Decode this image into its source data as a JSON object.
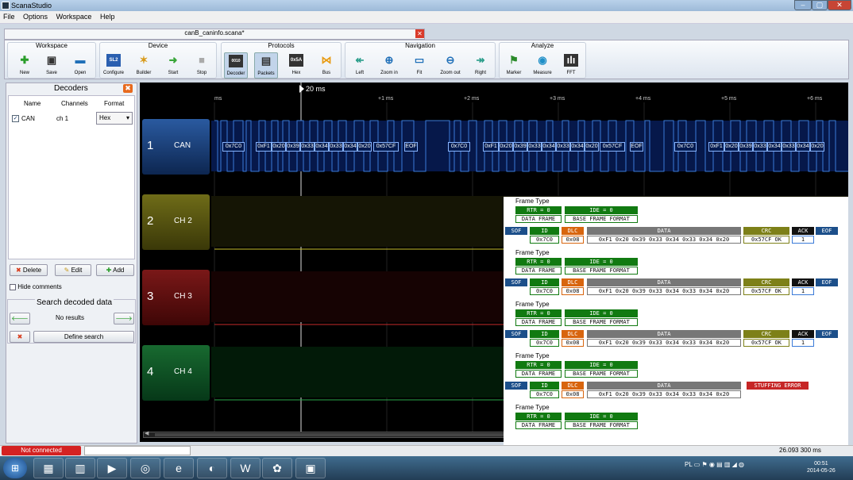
{
  "app": {
    "title": "ScanaStudio",
    "document_tab": "canB_caninfo.scana*"
  },
  "menu": [
    "File",
    "Options",
    "Workspace",
    "Help"
  ],
  "ribbon": {
    "groups": [
      {
        "title": "Workspace",
        "buttons": [
          "New",
          "Save",
          "Open"
        ]
      },
      {
        "title": "Device",
        "buttons": [
          "Configure",
          "Builder",
          "Start",
          "Stop"
        ]
      },
      {
        "title": "Protocols",
        "buttons": [
          "Decoder",
          "Packets",
          "Hex",
          "Bus"
        ]
      },
      {
        "title": "Navigation",
        "buttons": [
          "Left",
          "Zoom in",
          "Fit",
          "Zoom out",
          "Right"
        ]
      },
      {
        "title": "Analyze",
        "buttons": [
          "Marker",
          "Measure",
          "FFT"
        ]
      }
    ],
    "icon_texts": {
      "configure": "SL2",
      "decoder": "0010",
      "hex": "0x5A"
    }
  },
  "decoders": {
    "title": "Decoders",
    "headers": [
      "Name",
      "Channels",
      "Format"
    ],
    "rows": [
      {
        "name": "CAN",
        "channels": "ch 1",
        "format": "Hex"
      }
    ],
    "delete_label": "Delete",
    "edit_label": "Edit",
    "add_label": "Add",
    "hide_comments_label": "Hide comments"
  },
  "search": {
    "title": "Search decoded data",
    "result_text": "No results",
    "define_label": "Define search"
  },
  "waveform": {
    "cursor_label": "20 ms",
    "ticks": [
      "ms",
      "+1 ms",
      "+2 ms",
      "+3 ms",
      "+4 ms",
      "+5 ms",
      "+6 ms"
    ],
    "channels": [
      {
        "num": "1",
        "name": "CAN",
        "color": "#1a3f7a"
      },
      {
        "num": "2",
        "name": "CH 2",
        "color": "#5c5a10"
      },
      {
        "num": "3",
        "name": "CH 3",
        "color": "#6a1010"
      },
      {
        "num": "4",
        "name": "CH 4",
        "color": "#10502a"
      }
    ],
    "decoded_frames": [
      [
        "0x7C0",
        "0xF1",
        "0x20",
        "0x39",
        "0x33",
        "0x34",
        "0x33",
        "0x34",
        "0x20",
        "0x57CF",
        "EOF"
      ],
      [
        "0x7C0",
        "0xF1",
        "0x20",
        "0x39",
        "0x33",
        "0x34",
        "0x33",
        "0x34",
        "0x20",
        "0x57CF",
        "EOF"
      ],
      [
        "0x7C0",
        "0xF1",
        "0x20",
        "0x39",
        "0x33",
        "0x34",
        "0x33",
        "0x34",
        "0x20"
      ]
    ]
  },
  "packets": {
    "frame_type_label": "Frame Type",
    "rtr": "RTR = 0",
    "ide": "IDE = 0",
    "data_frame": "DATA FRAME",
    "base_frame_format": "BASE FRAME FORMAT",
    "headers": {
      "sof": "SOF",
      "id": "ID",
      "dlc": "DLC",
      "data": "DATA",
      "crc": "CRC",
      "ack": "ACK",
      "eof": "EOF"
    },
    "id_value": "0x7C0",
    "dlc_value": "0x08",
    "data_value": "0xF1 0x20 0x39 0x33 0x34 0x33 0x34 0x20",
    "crc_value": "0x57CF OK",
    "ack_value": "1",
    "stuffing_error": "STUFFING ERROR"
  },
  "status": {
    "connection": "Not connected",
    "time": "26.093 300 ms"
  },
  "taskbar": {
    "lang": "PL",
    "time": "00:51",
    "date": "2014-05-26"
  }
}
